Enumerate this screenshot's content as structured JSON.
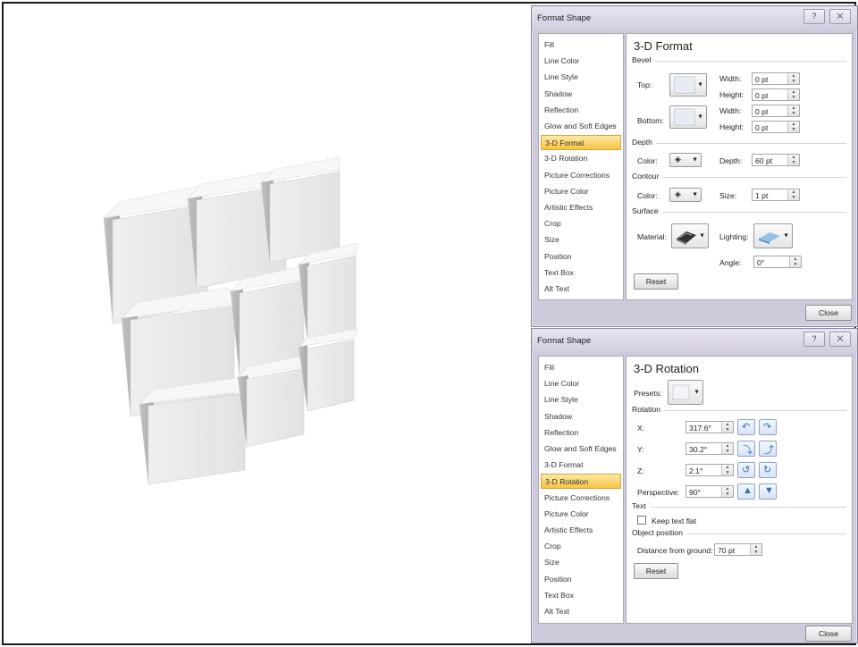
{
  "dialog1": {
    "title": "Format Shape",
    "help_label": "?",
    "close_x_label": "⨉",
    "nav_items": [
      "Fill",
      "Line Color",
      "Line Style",
      "Shadow",
      "Reflection",
      "Glow and Soft Edges",
      "3-D Format",
      "3-D Rotation",
      "Picture Corrections",
      "Picture Color",
      "Artistic Effects",
      "Crop",
      "Size",
      "Position",
      "Text Box",
      "Alt Text"
    ],
    "selected_nav": "3-D Format",
    "pane_title": "3-D Format",
    "bevel": {
      "section": "Bevel",
      "top_label": "Top:",
      "bottom_label": "Bottom:",
      "width_label": "Width:",
      "height_label": "Height:",
      "top_width": "0 pt",
      "top_height": "0 pt",
      "bottom_width": "0 pt",
      "bottom_height": "0 pt"
    },
    "depth": {
      "section": "Depth",
      "color_label": "Color:",
      "depth_label": "Depth:",
      "depth_value": "60 pt"
    },
    "contour": {
      "section": "Contour",
      "color_label": "Color:",
      "size_label": "Size:",
      "size_value": "1 pt"
    },
    "surface": {
      "section": "Surface",
      "material_label": "Material:",
      "lighting_label": "Lighting:",
      "angle_label": "Angle:",
      "angle_value": "0°"
    },
    "reset_label": "Reset",
    "close_label": "Close"
  },
  "dialog2": {
    "title": "Format Shape",
    "help_label": "?",
    "close_x_label": "⨉",
    "nav_items": [
      "Fill",
      "Line Color",
      "Line Style",
      "Shadow",
      "Reflection",
      "Glow and Soft Edges",
      "3-D Format",
      "3-D Rotation",
      "Picture Corrections",
      "Picture Color",
      "Artistic Effects",
      "Crop",
      "Size",
      "Position",
      "Text Box",
      "Alt Text"
    ],
    "selected_nav": "3-D Rotation",
    "pane_title": "3-D Rotation",
    "presets_label": "Presets:",
    "rotation": {
      "section": "Rotation",
      "x_label": "X:",
      "y_label": "Y:",
      "z_label": "Z:",
      "perspective_label": "Perspective:",
      "x_value": "317.6°",
      "y_value": "30.2°",
      "z_value": "2.1°",
      "perspective_value": "90°"
    },
    "text": {
      "section": "Text",
      "keep_flat_label": "Keep text flat"
    },
    "object_position": {
      "section": "Object position",
      "distance_label": "Distance from ground:",
      "distance_value": "70 pt"
    },
    "reset_label": "Reset",
    "close_label": "Close"
  },
  "colors": {
    "dialog_bg": "#cfc9dc",
    "selected_nav": "#f6c542",
    "cube_front": "#e9e9e9",
    "cube_top": "#f7f7f7",
    "cube_side": "#b9b9b9"
  }
}
